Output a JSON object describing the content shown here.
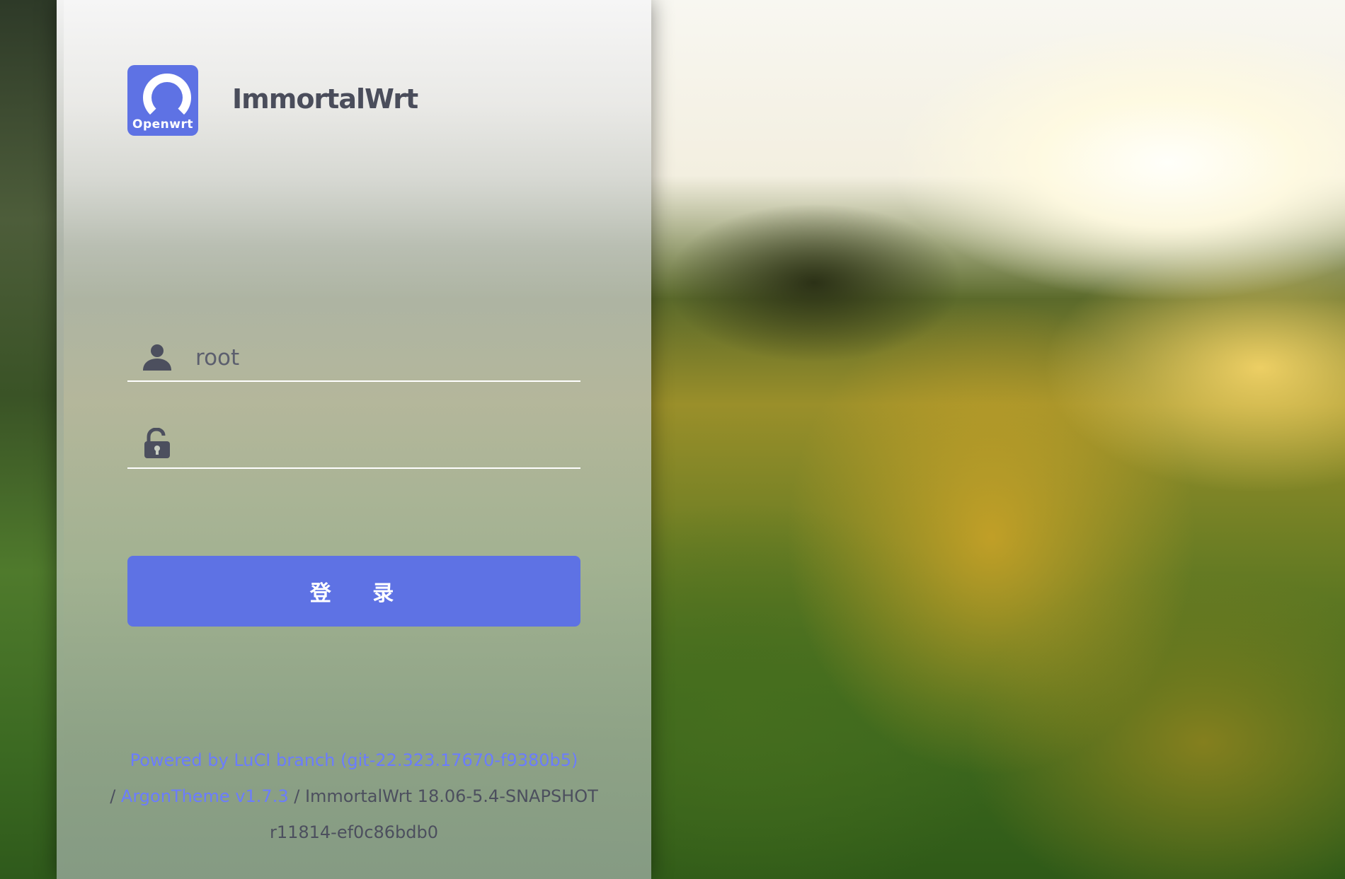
{
  "brand": {
    "logo_text": "Openwrt",
    "name": "ImmortalWrt"
  },
  "login_form": {
    "username_value": "root",
    "password_value": "",
    "submit_label": "登 录"
  },
  "footer": {
    "powered_by": "Powered by LuCI branch (git-22.323.17670-f9380b5)",
    "separator1": "/ ",
    "theme": "ArgonTheme v1.7.3",
    "separator2": " / ",
    "version": "ImmortalWrt 18.06-5.4-SNAPSHOT r11814-ef0c86bdb0"
  },
  "colors": {
    "accent": "#5e72e4",
    "link": "#6b7cff",
    "text": "#4c4f5e"
  },
  "icons": {
    "user": "user-icon",
    "lock": "lock-icon"
  }
}
